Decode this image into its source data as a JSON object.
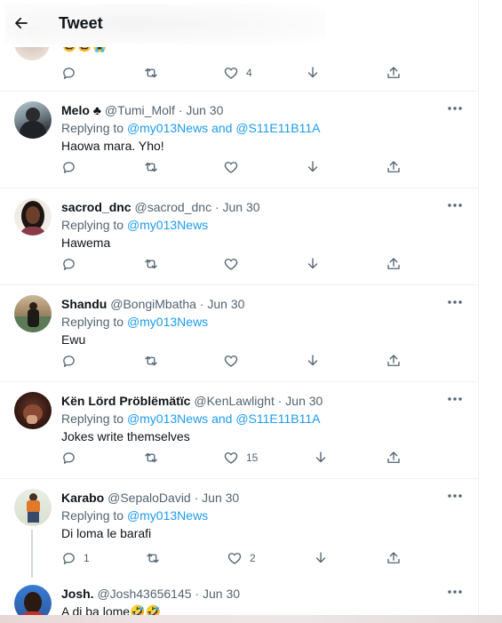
{
  "header": {
    "title": "Tweet",
    "back_icon": "arrow-left-icon"
  },
  "previous_tweet": {
    "text": "😅😅😭",
    "like_count": "4"
  },
  "colors": {
    "accent": "#1d9bf0",
    "secondary_text": "#536471",
    "primary_text": "#0f1419",
    "divider": "#eff3f4"
  },
  "replies": [
    {
      "name": "Melo ♣",
      "handle": "@Tumi_Molf",
      "date": "· Jun 30",
      "replying_prefix": "Replying to ",
      "mentions": "@my013News and @S11E11B11A",
      "text": "Haowa mara. Yho!",
      "reply_count": "",
      "like_count": ""
    },
    {
      "name": "sacrod_dnc",
      "handle": "@sacrod_dnc",
      "date": "· Jun 30",
      "replying_prefix": "Replying to ",
      "mentions": "@my013News",
      "text": "Hawema",
      "reply_count": "",
      "like_count": ""
    },
    {
      "name": "Shandu",
      "handle": "@BongiMbatha",
      "date": "· Jun 30",
      "replying_prefix": "Replying to ",
      "mentions": "@my013News",
      "text": "Ewu",
      "reply_count": "",
      "like_count": ""
    },
    {
      "name": "Kën Lörd Pröblëmätïc",
      "handle": "@KenLawlight",
      "date": "· Jun 30",
      "replying_prefix": "Replying to ",
      "mentions": "@my013News and @S11E11B11A",
      "text": "Jokes write themselves",
      "reply_count": "",
      "like_count": "15"
    },
    {
      "name": "Karabo",
      "handle": "@SepaloDavid",
      "date": "· Jun 30",
      "replying_prefix": "Replying to ",
      "mentions": "@my013News",
      "text": "Di loma le barafi",
      "reply_count": "1",
      "like_count": "2"
    },
    {
      "name": "Josh.",
      "handle": "@Josh43656145",
      "date": "· Jun 30",
      "text": "A di ba lome🤣🤣"
    }
  ]
}
